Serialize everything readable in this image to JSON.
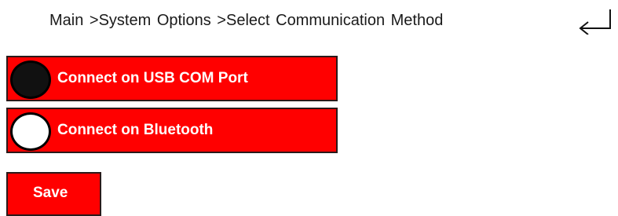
{
  "breadcrumb": {
    "text": "Main >System Options >Select Communication Method"
  },
  "back_icon": "return-arrow-icon",
  "options": [
    {
      "label": "Connect on USB COM Port",
      "selected": true
    },
    {
      "label": "Connect on Bluetooth",
      "selected": false
    }
  ],
  "save": {
    "label": "Save"
  },
  "colors": {
    "accent": "#ff0000",
    "text_on_accent": "#ffffff",
    "radio_selected": "#111111",
    "radio_unselected": "#ffffff"
  }
}
